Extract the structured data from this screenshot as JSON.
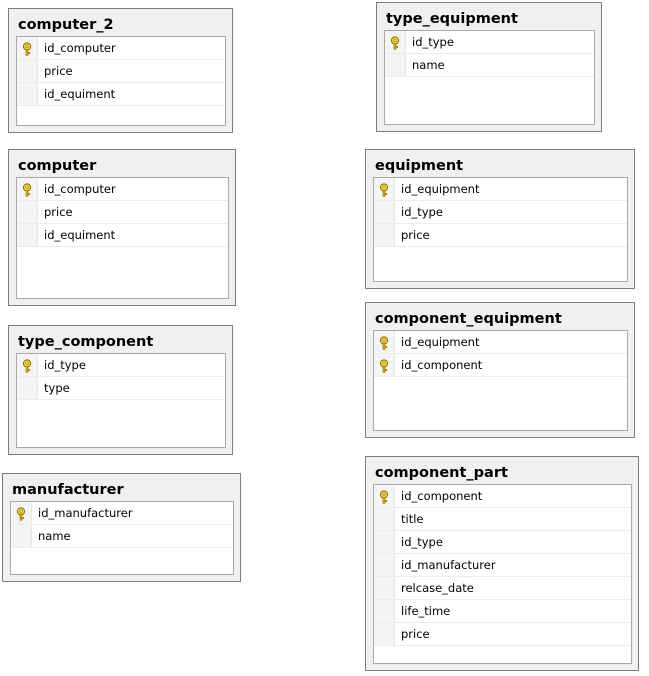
{
  "tables": [
    {
      "id": "computer_2",
      "title": "computer_2",
      "columns": [
        {
          "name": "id_computer",
          "pk": true
        },
        {
          "name": "price",
          "pk": false
        },
        {
          "name": "id_equiment",
          "pk": false
        }
      ]
    },
    {
      "id": "computer",
      "title": "computer",
      "columns": [
        {
          "name": "id_computer",
          "pk": true
        },
        {
          "name": "price",
          "pk": false
        },
        {
          "name": "id_equiment",
          "pk": false
        }
      ]
    },
    {
      "id": "type_component",
      "title": "type_component",
      "columns": [
        {
          "name": "id_type",
          "pk": true
        },
        {
          "name": "type",
          "pk": false
        }
      ]
    },
    {
      "id": "manufacturer",
      "title": "manufacturer",
      "columns": [
        {
          "name": "id_manufacturer",
          "pk": true
        },
        {
          "name": "name",
          "pk": false
        }
      ]
    },
    {
      "id": "type_equipment",
      "title": "type_equipment",
      "columns": [
        {
          "name": "id_type",
          "pk": true
        },
        {
          "name": "name",
          "pk": false
        }
      ]
    },
    {
      "id": "equipment",
      "title": "equipment",
      "columns": [
        {
          "name": "id_equipment",
          "pk": true
        },
        {
          "name": "id_type",
          "pk": false
        },
        {
          "name": "price",
          "pk": false
        }
      ]
    },
    {
      "id": "component_equipment",
      "title": "component_equipment",
      "columns": [
        {
          "name": "id_equipment",
          "pk": true
        },
        {
          "name": "id_component",
          "pk": true
        }
      ]
    },
    {
      "id": "component_part",
      "title": "component_part",
      "columns": [
        {
          "name": "id_component",
          "pk": true
        },
        {
          "name": "title",
          "pk": false
        },
        {
          "name": "id_type",
          "pk": false
        },
        {
          "name": "id_manufacturer",
          "pk": false
        },
        {
          "name": "relcase_date",
          "pk": false
        },
        {
          "name": "life_time",
          "pk": false
        },
        {
          "name": "price",
          "pk": false
        }
      ]
    }
  ]
}
